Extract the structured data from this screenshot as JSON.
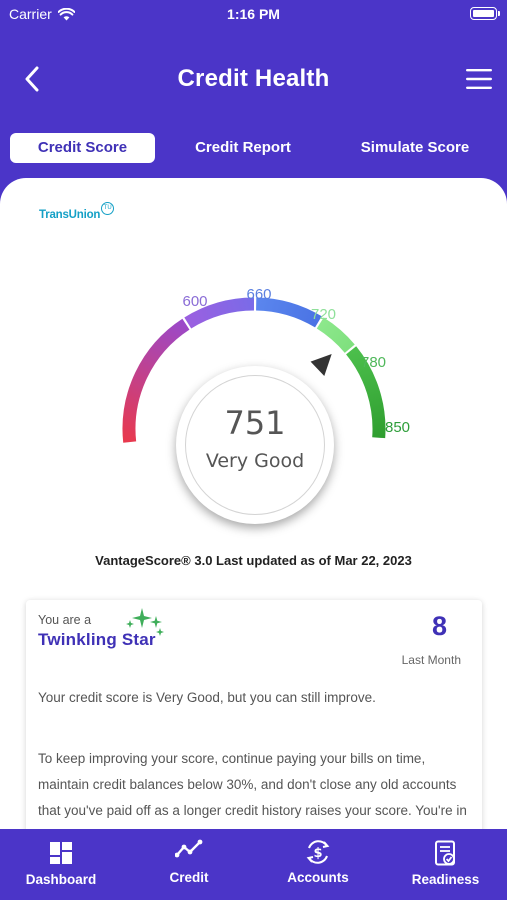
{
  "status_bar": {
    "carrier": "Carrier",
    "time": "1:16 PM"
  },
  "header": {
    "title": "Credit Health"
  },
  "tabs": [
    {
      "label": "Credit Score",
      "active": true
    },
    {
      "label": "Credit Report",
      "active": false
    },
    {
      "label": "Simulate Score",
      "active": false
    }
  ],
  "bureau": {
    "logo_text": "TransUnion",
    "logo_mark": "TU"
  },
  "gauge": {
    "min": 300,
    "max": 850,
    "score": "751",
    "score_numeric": 751,
    "rating": "Very Good",
    "tick_labels": [
      "600",
      "660",
      "720",
      "780",
      "850"
    ],
    "tick_colors": [
      "#8a6cd6",
      "#5a7fe0",
      "#8fe09a",
      "#4fb85a",
      "#2e9e3a"
    ],
    "segments": [
      {
        "from_color": "#e8394e",
        "to_color": "#9b49c9"
      },
      {
        "from_color": "#9b5fe0",
        "to_color": "#7a6be8"
      },
      {
        "from_color": "#5b86ee",
        "to_color": "#4a73e4"
      },
      {
        "from_color": "#8de88c",
        "to_color": "#7fe07e"
      },
      {
        "from_color": "#4cbf4c",
        "to_color": "#2f9e2f"
      }
    ]
  },
  "vantage_text": "VantageScore® 3.0 Last updated as of Mar 22, 2023",
  "info": {
    "you_are": "You are a",
    "persona": "Twinkling Star",
    "rank_value": "8",
    "rank_label": "Last Month",
    "paragraph1": "Your credit score is Very Good, but you can still improve.",
    "paragraph2": "To keep improving your score, continue paying your bills on time, maintain credit balances below 30%, and don't close any old accounts that you've paid off as a longer credit history raises your score. You're in a good position to be offered better"
  },
  "bottom_nav": [
    {
      "label": "Dashboard",
      "icon": "dashboard-grid-icon"
    },
    {
      "label": "Credit",
      "icon": "trend-line-icon"
    },
    {
      "label": "Accounts",
      "icon": "dollar-sync-icon"
    },
    {
      "label": "Readiness",
      "icon": "checklist-document-icon"
    }
  ],
  "colors": {
    "brand": "#4b35c8",
    "accent": "#3f31b6",
    "white": "#ffffff"
  }
}
